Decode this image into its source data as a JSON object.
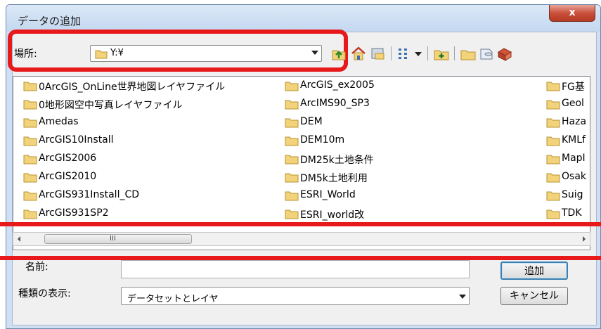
{
  "window": {
    "title": "データの追加",
    "close_label": "x"
  },
  "location": {
    "label": "場所:",
    "value": "Y:¥"
  },
  "toolbar": {
    "icons": [
      "up-one-level-icon",
      "home-icon",
      "connect-folder-icon",
      "list-view-icon",
      "view-dropdown-icon",
      "new-folder-icon",
      "folder-icon",
      "database-icon",
      "catalog-icon"
    ]
  },
  "file_list": {
    "columns": [
      [
        "0ArcGIS_OnLine世界地図レイヤファイル",
        "0地形図空中写真レイヤファイル",
        "Amedas",
        "ArcGIS10Install",
        "ArcGIS2006",
        "ArcGIS2010",
        "ArcGIS931Install_CD",
        "ArcGIS931SP2"
      ],
      [
        "ArcGIS_ex2005",
        "ArcIMS90_SP3",
        "DEM",
        "DEM10m",
        "DM25k土地条件",
        "DM5k土地利用",
        "ESRI_World",
        "ESRI_world改"
      ],
      [
        "FG基",
        "Geol",
        "Haza",
        "KMLf",
        "MapI",
        "Osak",
        "Suig",
        "TDK"
      ]
    ]
  },
  "scrollbar": {
    "grip": "III"
  },
  "name_field": {
    "label": "名前:",
    "value": ""
  },
  "type_field": {
    "label": "種類の表示:",
    "value": "データセットとレイヤ"
  },
  "buttons": {
    "add": "追加",
    "cancel": "キャンセル"
  },
  "colors": {
    "highlight": "#e8191b",
    "folder": "#f2d27a"
  }
}
